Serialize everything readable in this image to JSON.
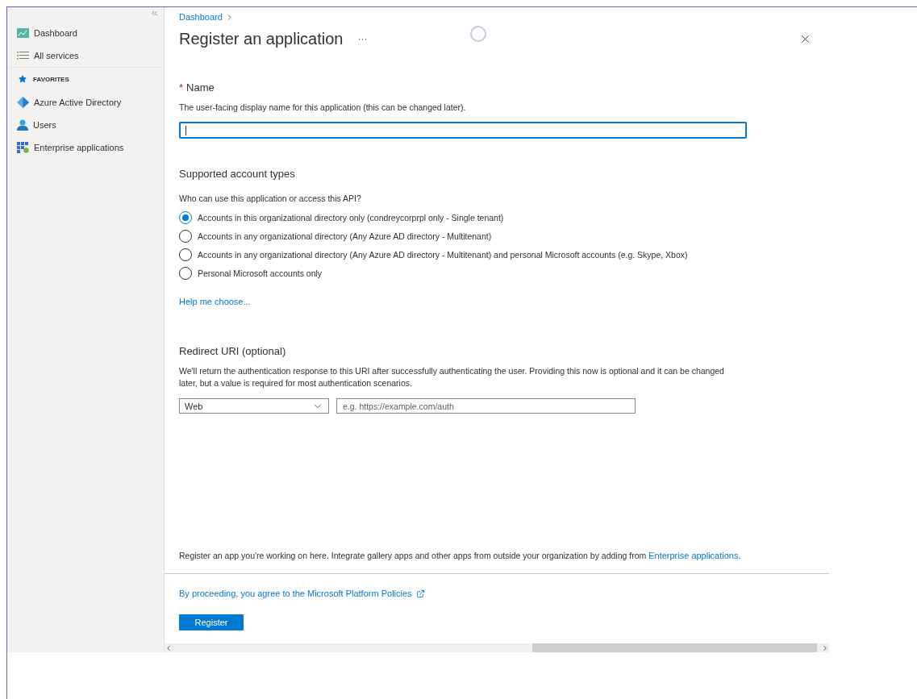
{
  "sidebar": {
    "items": [
      {
        "label": "Dashboard",
        "kind": "nav"
      },
      {
        "label": "All services",
        "kind": "nav"
      },
      {
        "label": "FAVORITES",
        "kind": "header"
      },
      {
        "label": "Azure Active Directory",
        "kind": "nav"
      },
      {
        "label": "Users",
        "kind": "nav"
      },
      {
        "label": "Enterprise applications",
        "kind": "nav"
      }
    ]
  },
  "breadcrumb": [
    "Dashboard"
  ],
  "title": "Register an application",
  "more": "···",
  "name_field": {
    "label": "Name",
    "required_mark": "*",
    "description": "The user-facing display name for this application (this can be changed later).",
    "focused": true
  },
  "account_types": {
    "heading": "Supported account types",
    "question": "Who can use this application or access this API?",
    "options": [
      {
        "label": "Accounts in this organizational directory only (condreycorprpl only - Single tenant)",
        "selected": true
      },
      {
        "label": "Accounts in any organizational directory (Any Azure AD directory - Multitenant)",
        "selected": false
      },
      {
        "label": "Accounts in any organizational directory (Any Azure AD directory - Multitenant) and personal Microsoft accounts (e.g. Skype, Xbox)",
        "selected": false
      },
      {
        "label": "Personal Microsoft accounts only",
        "selected": false
      }
    ],
    "help_link": "Help me choose..."
  },
  "redirect": {
    "heading": "Redirect URI (optional)",
    "description": "We'll return the authentication response to this URI after successfully authenticating the user. Providing this now is optional and it can be changed later, but a value is required for most authentication scenarios.",
    "platform": "Web",
    "uri_placeholder": "e.g. https://example.com/auth"
  },
  "footer_note": {
    "text": "Register an app you're working on here. Integrate gallery apps and other apps from outside your organization by adding from ",
    "link": "Enterprise applications",
    "suffix": "."
  },
  "policy_link": "By proceeding, you agree to the Microsoft Platform Policies",
  "register_button": "Register"
}
